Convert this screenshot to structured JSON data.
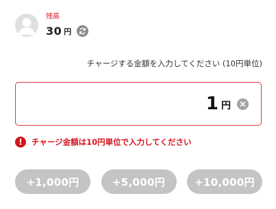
{
  "balance": {
    "label": "残高",
    "amount": "30",
    "unit": "円"
  },
  "instruction": "チャージする金額を入力してください (10円単位)",
  "input": {
    "value": "1",
    "unit": "円"
  },
  "error": {
    "icon": "!",
    "message": "チャージ金額は10円単位で入力してください"
  },
  "quick_amounts": [
    {
      "label": "+1,000円"
    },
    {
      "label": "+5,000円"
    },
    {
      "label": "+10,000円"
    }
  ],
  "colors": {
    "accent_red": "#d6141f",
    "button_gray": "#c4c4c4"
  }
}
